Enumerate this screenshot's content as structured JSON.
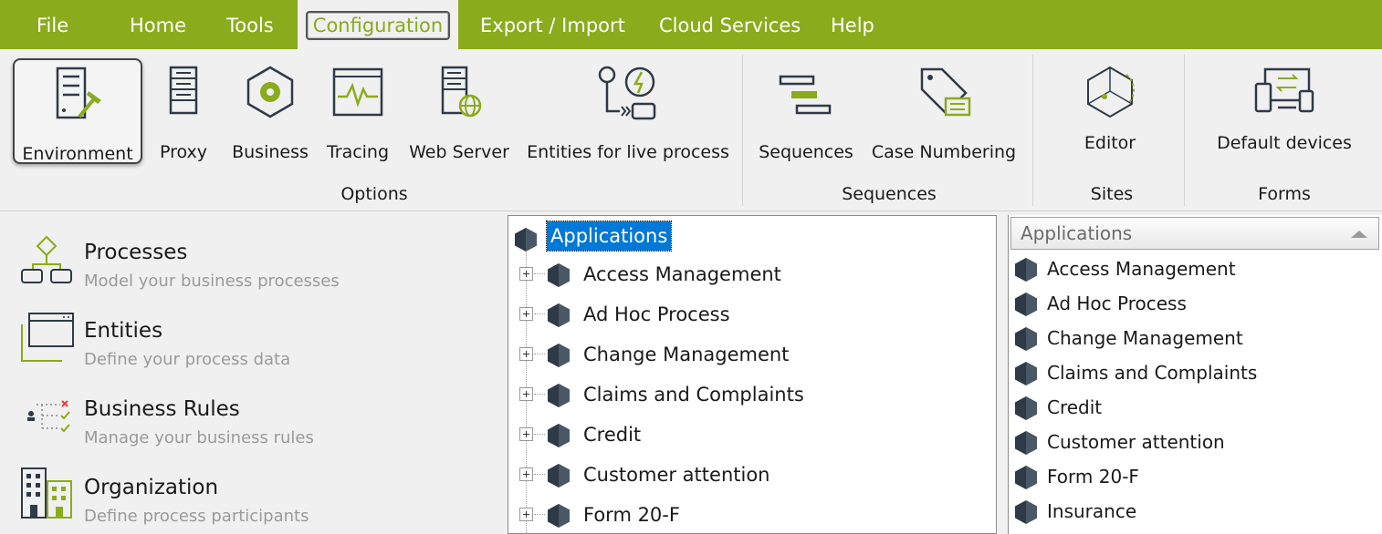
{
  "menu": {
    "file": "File",
    "home": "Home",
    "tools": "Tools",
    "configuration": "Configuration",
    "export_import": "Export / Import",
    "cloud_services": "Cloud Services",
    "help": "Help"
  },
  "ribbon": {
    "options": {
      "group_label": "Options",
      "environment": "Environment",
      "proxy": "Proxy",
      "business": "Business",
      "tracing": "Tracing",
      "web_server": "Web Server",
      "entities_live": "Entities for live process"
    },
    "sequences": {
      "group_label": "Sequences",
      "sequences": "Sequences",
      "case_numbering": "Case Numbering"
    },
    "sites": {
      "group_label": "Sites",
      "editor": "Editor"
    },
    "forms": {
      "group_label": "Forms",
      "default_devices": "Default devices"
    }
  },
  "left_pane": {
    "items": [
      {
        "title": "Processes",
        "subtitle": "Model your business processes"
      },
      {
        "title": "Entities",
        "subtitle": "Define your process data"
      },
      {
        "title": "Business Rules",
        "subtitle": "Manage your business rules"
      },
      {
        "title": "Organization",
        "subtitle": "Define process participants"
      }
    ]
  },
  "tree": {
    "root": "Applications",
    "items": [
      "Access Management",
      "Ad Hoc Process",
      "Change Management",
      "Claims and Complaints",
      "Credit",
      "Customer attention",
      "Form 20-F"
    ]
  },
  "list": {
    "header": "Applications",
    "items": [
      "Access Management",
      "Ad Hoc Process",
      "Change Management",
      "Claims and Complaints",
      "Credit",
      "Customer attention",
      "Form 20-F",
      "Insurance"
    ]
  },
  "colors": {
    "brand_green": "#8aab1c",
    "icon_dark": "#2e3a47",
    "selection_blue": "#0078d7"
  }
}
